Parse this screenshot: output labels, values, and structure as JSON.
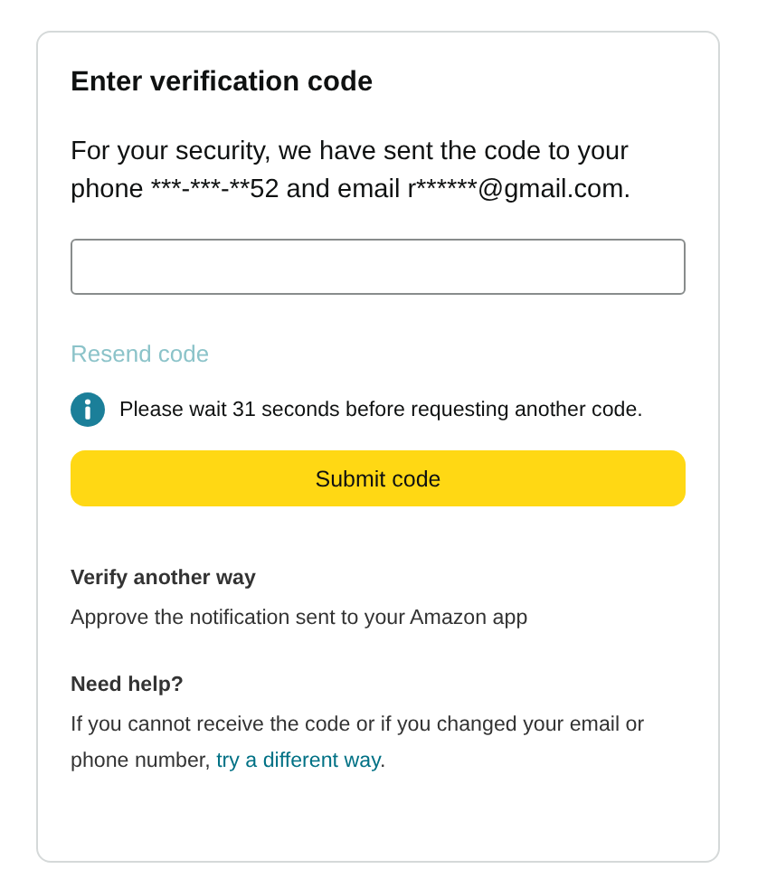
{
  "card": {
    "title": "Enter verification code",
    "message": "For your security, we have sent the code to your phone ***-***-**52 and email r******@gmail.com.",
    "resend": {
      "label": "Resend code",
      "disabled": true
    },
    "notice": {
      "kind": "info",
      "text": "Please wait 31 seconds before requesting another code."
    },
    "submit": {
      "label": "Submit code"
    },
    "sections": [
      {
        "heading": "Verify another way",
        "text": "Approve the notification sent to your Amazon app"
      },
      {
        "heading": "Need help?",
        "text": "If you cannot receive the code or if you changed your email or phone number, ",
        "link": "try a different way",
        "after": "."
      }
    ]
  }
}
